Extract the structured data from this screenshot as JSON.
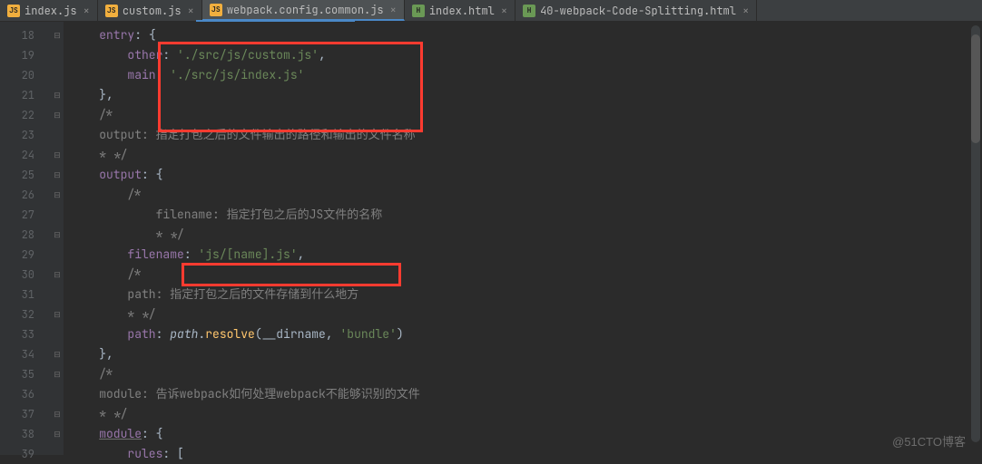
{
  "tabs": [
    {
      "label": "index.js",
      "iconType": "js"
    },
    {
      "label": "custom.js",
      "iconType": "js"
    },
    {
      "label": "webpack.config.common.js",
      "iconType": "js",
      "active": true
    },
    {
      "label": "index.html",
      "iconType": "html"
    },
    {
      "label": "40-webpack-Code-Splitting.html",
      "iconType": "html"
    }
  ],
  "lineStart": 18,
  "lineEnd": 39,
  "code": {
    "l18": {
      "indent": "    ",
      "prop": "entry",
      "after": ": {"
    },
    "l19": {
      "indent": "        ",
      "prop": "other",
      "mid": ": ",
      "str": "'./src/js/custom.js'",
      "after": ","
    },
    "l20": {
      "indent": "        ",
      "prop": "main",
      "mid": ": ",
      "str": "'./src/js/index.js'"
    },
    "l21": {
      "indent": "    ",
      "text": "},"
    },
    "l22": {
      "indent": "    ",
      "cmt": "/*"
    },
    "l23": {
      "indent": "    ",
      "cmt": "output: 指定打包之后的文件输出的路径和输出的文件名称"
    },
    "l24": {
      "indent": "    ",
      "cmt": "* */"
    },
    "l25": {
      "indent": "    ",
      "prop": "output",
      "after": ": {"
    },
    "l26": {
      "indent": "        ",
      "cmt": "/*"
    },
    "l27": {
      "indent": "            ",
      "cmt": "filename: 指定打包之后的JS文件的名称"
    },
    "l28": {
      "indent": "            ",
      "cmt": "* */"
    },
    "l29": {
      "indent": "        ",
      "prop": "filename",
      "mid": ": ",
      "str": "'js/[name].js'",
      "after": ","
    },
    "l30": {
      "indent": "        ",
      "cmt": "/*"
    },
    "l31": {
      "indent": "        ",
      "cmt": "path: 指定打包之后的文件存储到什么地方"
    },
    "l32": {
      "indent": "        ",
      "cmt": "* */"
    },
    "l33": {
      "indent": "        ",
      "prop": "path",
      "mid": ": ",
      "obj": "path",
      "dot": ".",
      "func": "resolve",
      "args_open": "(",
      "arg1": "__dirname",
      "comma": ", ",
      "arg2": "'bundle'",
      "args_close": ")"
    },
    "l34": {
      "indent": "    ",
      "text": "},"
    },
    "l35": {
      "indent": "    ",
      "cmt": "/*"
    },
    "l36": {
      "indent": "    ",
      "cmt": "module: 告诉webpack如何处理webpack不能够识别的文件"
    },
    "l37": {
      "indent": "    ",
      "cmt": "* */"
    },
    "l38": {
      "indent": "    ",
      "prop": "module",
      "after": ": {",
      "underline": true
    },
    "l39": {
      "indent": "        ",
      "prop": "rules",
      "after": ": ["
    }
  },
  "watermark": "@51CTO博客"
}
